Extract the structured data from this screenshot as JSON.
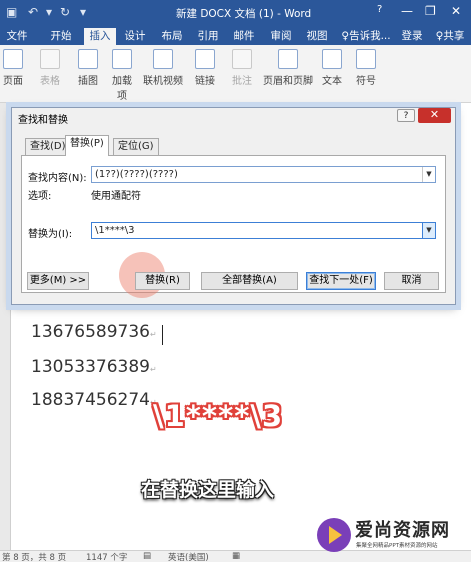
{
  "titlebar": {
    "title": "新建 DOCX 文档 (1) - Word",
    "help_glyph": "?",
    "minimize_glyph": "—",
    "restore_glyph": "❐",
    "close_glyph": "✕"
  },
  "tabs": [
    {
      "label": "文件"
    },
    {
      "label": "开始"
    },
    {
      "label": "插入",
      "active": true
    },
    {
      "label": "设计"
    },
    {
      "label": "布局"
    },
    {
      "label": "引用"
    },
    {
      "label": "邮件"
    },
    {
      "label": "审阅"
    },
    {
      "label": "视图"
    },
    {
      "label": "♀告诉我..."
    },
    {
      "label": "登录"
    },
    {
      "label": "♀共享"
    }
  ],
  "ribbon": {
    "items": [
      {
        "label": "页面",
        "icon": "page-icon"
      },
      {
        "label": "表格",
        "icon": "table-icon",
        "disabled": true
      },
      {
        "label": "插图",
        "icon": "illustration-icon"
      },
      {
        "label": "加载项",
        "icon": "addins-icon"
      },
      {
        "label": "联机视频",
        "icon": "video-icon"
      },
      {
        "label": "链接",
        "icon": "link-icon"
      },
      {
        "label": "批注",
        "icon": "comment-icon",
        "disabled": true
      },
      {
        "label": "页眉和页脚",
        "icon": "header-footer-icon"
      },
      {
        "label": "文本",
        "icon": "text-icon"
      },
      {
        "label": "符号",
        "icon": "symbol-icon"
      }
    ]
  },
  "dialog": {
    "title": "查找和替换",
    "help": "?",
    "close": "✕",
    "tabs": {
      "find": "查找(D)",
      "replace": "替换(P)",
      "goto": "定位(G)"
    },
    "find_label": "查找内容(N):",
    "find_value": "(1??)(????)(????)",
    "options_label": "选项:",
    "options_value": "使用通配符",
    "replace_label": "替换为(I):",
    "replace_value": "\\1****\\3",
    "buttons": {
      "more": "更多(M) >>",
      "replace": "替换(R)",
      "replace_all": "全部替换(A)",
      "find_next": "查找下一处(F)",
      "cancel": "取消"
    }
  },
  "document": {
    "lines": [
      "13676589736",
      "13053376389",
      "18837456274"
    ],
    "overlay_code": "\\1****\\3",
    "caption": "在替换这里输入"
  },
  "status": {
    "page": "第 8 页，共 8 页",
    "words": "1147 个字",
    "language": "英语(美国)"
  },
  "watermark": {
    "name": "爱尚资源网",
    "tagline": "集聚全网精品PPT素材资源的网站"
  }
}
